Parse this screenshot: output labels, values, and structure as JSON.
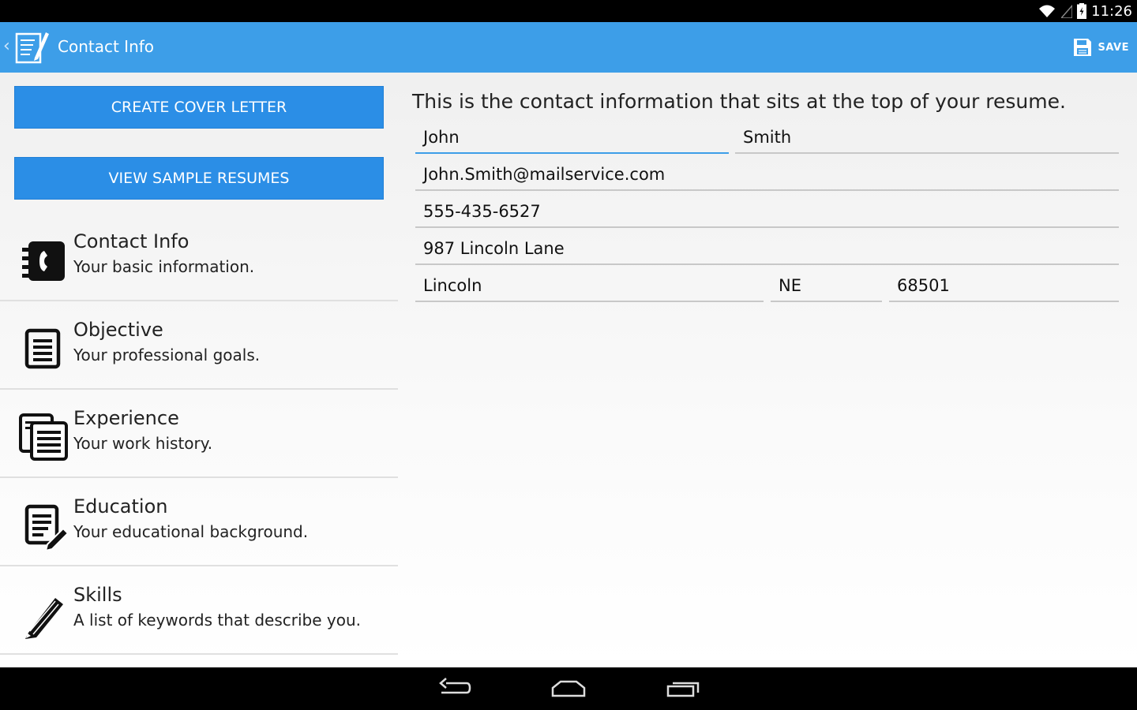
{
  "status_bar": {
    "time": "11:26"
  },
  "action_bar": {
    "title": "Contact Info",
    "save_label": "SAVE",
    "back_glyph": "‹"
  },
  "buttons": {
    "create_cover_letter": "CREATE COVER LETTER",
    "view_sample_resumes": "VIEW SAMPLE RESUMES"
  },
  "sections": [
    {
      "title": "Contact Info",
      "subtitle": "Your basic information.",
      "icon": "contact-book-icon"
    },
    {
      "title": "Objective",
      "subtitle": "Your professional goals.",
      "icon": "document-icon"
    },
    {
      "title": "Experience",
      "subtitle": "Your work history.",
      "icon": "documents-stack-icon"
    },
    {
      "title": "Education",
      "subtitle": "Your educational background.",
      "icon": "document-pencil-icon"
    },
    {
      "title": "Skills",
      "subtitle": "A list of keywords that describe you.",
      "icon": "pencil-icon"
    }
  ],
  "form": {
    "intro": "This is the contact information that sits at the top of your resume.",
    "first_name": "John",
    "last_name": "Smith",
    "email": "John.Smith@mailservice.com",
    "phone": "555-435-6527",
    "address": "987 Lincoln Lane",
    "city": "Lincoln",
    "state": "NE",
    "zip": "68501"
  },
  "colors": {
    "action_bar": "#3d9ee8",
    "button_blue": "#2b8ee6",
    "focus_underline": "#3d9ee8"
  }
}
